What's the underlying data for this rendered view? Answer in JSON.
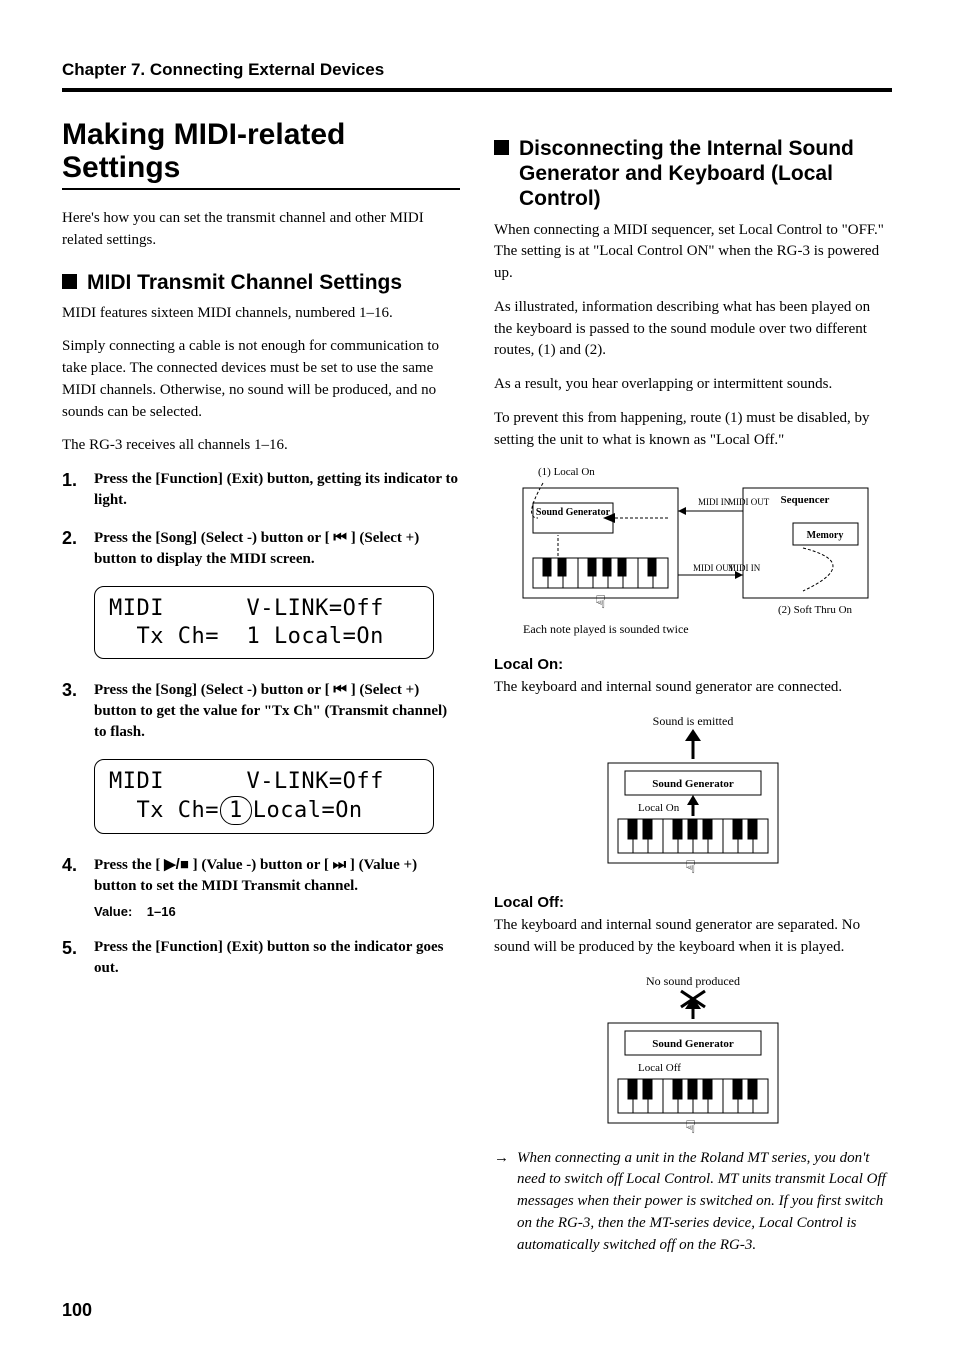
{
  "runningHead": "Chapter 7. Connecting External Devices",
  "left": {
    "h1": "Making MIDI-related Settings",
    "intro": "Here's how you can set the transmit channel and other MIDI related settings.",
    "h2": "MIDI Transmit Channel Settings",
    "p1": "MIDI features sixteen MIDI channels, numbered 1–16.",
    "p2": "Simply connecting a cable is not enough for communication to take place. The connected devices must be set to use the same MIDI channels. Otherwise, no sound will be produced, and no sounds can be selected.",
    "p3": "The RG-3 receives all channels 1–16.",
    "steps": {
      "s1": "Press the [Function] (Exit) button, getting its indicator to light.",
      "s2a": "Press the [Song] (Select -) button or [ ",
      "s2b": " ] (Select +) button to display the MIDI screen.",
      "lcd1_l1": "MIDI      V-LINK=Off",
      "lcd1_l2": "  Tx Ch=  1 Local=On",
      "s3a": "Press the [Song] (Select -) button or [ ",
      "s3b": " ] (Select +) button to get the value for \"Tx Ch\" (Transmit channel) to flash.",
      "lcd2_l1": "MIDI      V-LINK=Off",
      "lcd2_pre": "  Tx Ch=",
      "lcd2_flash": "1",
      "lcd2_post": "Local=On",
      "s4a": "Press the [ ",
      "s4b": " ] (Value -) button or [ ",
      "s4c": " ] (Value +) button to set the MIDI Transmit channel.",
      "s4meta_label": "Value:",
      "s4meta_val": "1–16",
      "s5": "Press the [Function] (Exit) button so the indicator goes out."
    }
  },
  "right": {
    "h2": "Disconnecting the Internal Sound Generator and Keyboard (Local Control)",
    "p1": "When connecting a MIDI sequencer, set Local Control to \"OFF.\" The setting is at \"Local Control ON\" when the RG-3 is powered up.",
    "p2": "As illustrated, information describing what has been played on the keyboard is passed to the sound module over two different routes, (1) and (2).",
    "p3": "As a result, you hear overlapping or intermittent sounds.",
    "p4": "To prevent this from happening, route (1) must be disabled, by setting the unit to what is known as \"Local Off.\"",
    "d1": {
      "localOn": "(1)  Local On",
      "soundGen": "Sound Generator",
      "sequencer": "Sequencer",
      "memory": "Memory",
      "midiIn": "MIDI IN",
      "midiOut": "MIDI OUT",
      "softThru": "(2)  Soft Thru On",
      "caption": "Each note played is sounded twice"
    },
    "localOnHead": "Local On:",
    "localOnBody": "The keyboard and internal sound generator are connected.",
    "d2": {
      "top": "Sound is emitted",
      "soundGen": "Sound Generator",
      "label": "Local On"
    },
    "localOffHead": "Local Off:",
    "localOffBody": "The keyboard and internal sound generator are separated. No sound will be produced by the keyboard when it is played.",
    "d3": {
      "top": "No sound produced",
      "soundGen": "Sound Generator",
      "label": "Local Off"
    },
    "note": "When connecting a unit in the Roland MT series, you don't need to switch off Local Control. MT units transmit Local Off messages when their power is switched on. If you first switch on the RG-3, then the MT-series device, Local Control is automatically switched off on the RG-3."
  },
  "pageNumber": "100"
}
